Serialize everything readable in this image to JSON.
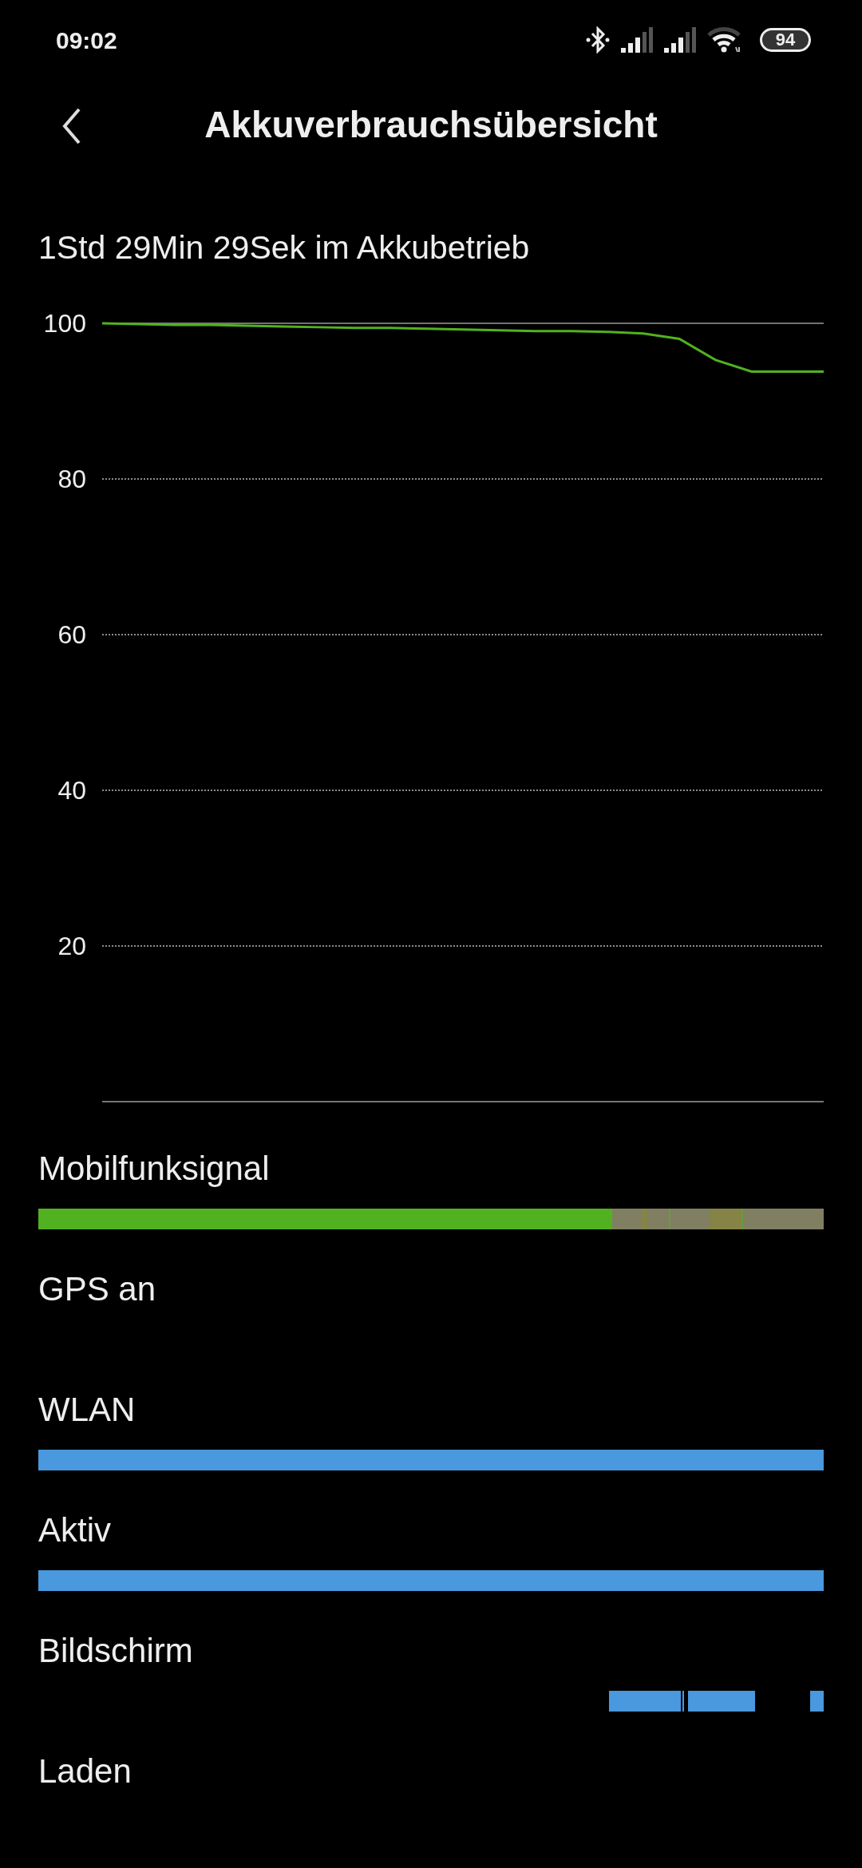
{
  "status_bar": {
    "time": "09:02",
    "battery": "94"
  },
  "header": {
    "title": "Akkuverbrauchsübersicht"
  },
  "summary": "1Std 29Min 29Sek im Akkubetrieb",
  "chart": {
    "chart_data": {
      "type": "line",
      "grid": true,
      "yticks": [
        20,
        40,
        60,
        80,
        100
      ],
      "ylim": [
        0,
        100
      ],
      "series": [
        {
          "color": "#52b120",
          "values": [
            100,
            99.9,
            99.8,
            99.8,
            99.7,
            99.6,
            99.5,
            99.4,
            99.4,
            99.3,
            99.2,
            99.1,
            99,
            99,
            98.9,
            98.7,
            98,
            95.3,
            93.8,
            93.8,
            93.8
          ]
        }
      ]
    }
  },
  "timelines": [
    {
      "label": "Mobilfunksignal",
      "kind": "signal"
    },
    {
      "label": "GPS an",
      "kind": "empty"
    },
    {
      "label": "WLAN",
      "kind": "solid"
    },
    {
      "label": "Aktiv",
      "kind": "solid"
    },
    {
      "label": "Bildschirm",
      "kind": "segments"
    },
    {
      "label": "Laden",
      "kind": "empty"
    }
  ]
}
